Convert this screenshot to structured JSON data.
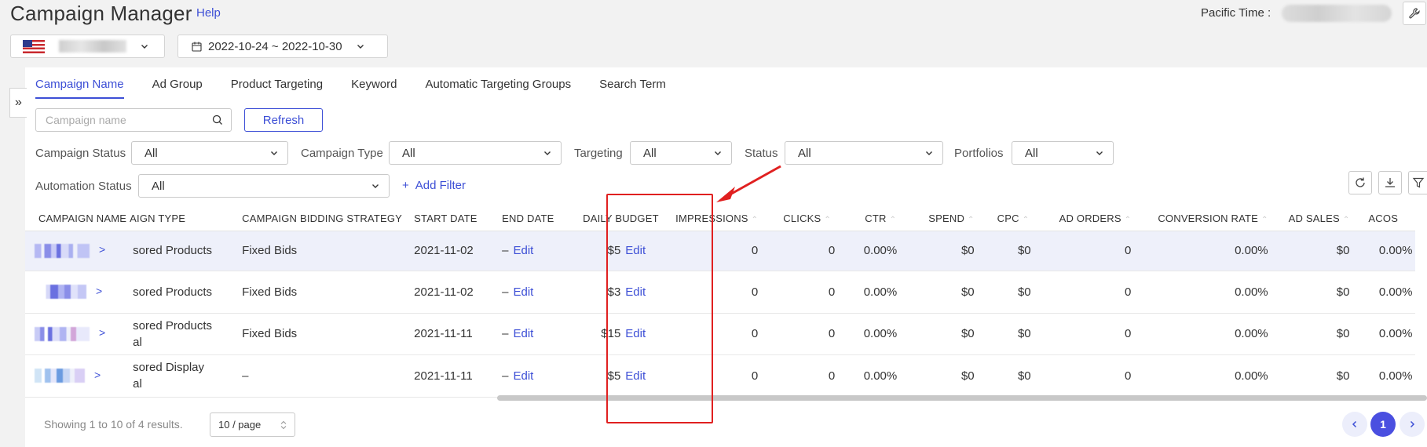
{
  "header": {
    "title": "Campaign Manager",
    "help": "Help",
    "pacific_time_label": "Pacific Time :"
  },
  "marketplace": {
    "flag": "us-flag-icon"
  },
  "date_range": "2022-10-24 ~ 2022-10-30",
  "tabs": [
    "Campaign Name",
    "Ad Group",
    "Product Targeting",
    "Keyword",
    "Automatic Targeting Groups",
    "Search Term"
  ],
  "search": {
    "placeholder": "Campaign name"
  },
  "refresh_label": "Refresh",
  "filters": {
    "campaign_status": {
      "label": "Campaign Status",
      "value": "All"
    },
    "campaign_type": {
      "label": "Campaign Type",
      "value": "All"
    },
    "targeting": {
      "label": "Targeting",
      "value": "All"
    },
    "status": {
      "label": "Status",
      "value": "All"
    },
    "portfolios": {
      "label": "Portfolios",
      "value": "All"
    },
    "automation_status": {
      "label": "Automation Status",
      "value": "All"
    },
    "add_filter": "Add Filter"
  },
  "table": {
    "headers": {
      "campaign_name": "CAMPAIGN NAME",
      "campaign_type": "AIGN TYPE",
      "bidding_strategy": "CAMPAIGN BIDDING STRATEGY",
      "start_date": "START DATE",
      "end_date": "END DATE",
      "daily_budget": "DAILY BUDGET",
      "impressions": "IMPRESSIONS",
      "clicks": "CLICKS",
      "ctr": "CTR",
      "spend": "SPEND",
      "cpc": "CPC",
      "ad_orders": "AD ORDERS",
      "conversion_rate": "CONVERSION RATE",
      "ad_sales": "AD SALES",
      "acos": "ACOS"
    },
    "rows": [
      {
        "type_line1": "sored Products",
        "type_line2": "",
        "strategy": "Fixed Bids",
        "start": "2021-11-02",
        "end": "–",
        "budget": "$5",
        "impressions": "0",
        "clicks": "0",
        "ctr": "0.00%",
        "spend": "$0",
        "cpc": "$0",
        "orders": "0",
        "conv": "0.00%",
        "sales": "$0",
        "acos": "0.00%"
      },
      {
        "type_line1": "sored Products",
        "type_line2": "",
        "strategy": "Fixed Bids",
        "start": "2021-11-02",
        "end": "–",
        "budget": "$3",
        "impressions": "0",
        "clicks": "0",
        "ctr": "0.00%",
        "spend": "$0",
        "cpc": "$0",
        "orders": "0",
        "conv": "0.00%",
        "sales": "$0",
        "acos": "0.00%"
      },
      {
        "type_line1": "sored Products",
        "type_line2": "al",
        "strategy": "Fixed Bids",
        "start": "2021-11-11",
        "end": "–",
        "budget": "$15",
        "impressions": "0",
        "clicks": "0",
        "ctr": "0.00%",
        "spend": "$0",
        "cpc": "$0",
        "orders": "0",
        "conv": "0.00%",
        "sales": "$0",
        "acos": "0.00%"
      },
      {
        "type_line1": "sored Display",
        "type_line2": "al",
        "strategy": "–",
        "start": "2021-11-11",
        "end": "–",
        "budget": "$5",
        "impressions": "0",
        "clicks": "0",
        "ctr": "0.00%",
        "spend": "$0",
        "cpc": "$0",
        "orders": "0",
        "conv": "0.00%",
        "sales": "$0",
        "acos": "0.00%"
      }
    ],
    "edit_label": "Edit"
  },
  "footer": {
    "showing": "Showing 1 to 10 of 4 results.",
    "page_size": "10 / page",
    "current_page": "1"
  },
  "colors": {
    "accent": "#3d4fd6",
    "annotation": "#e02020"
  }
}
